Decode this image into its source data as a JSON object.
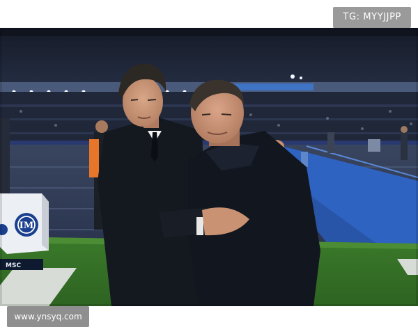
{
  "watermarks": {
    "top_right": "TG: MYYJJPP",
    "bottom_left": "www.ynsyq.com"
  },
  "scene": {
    "ad_box_logo": "inter-crest-icon",
    "ad_board_text": "MSC",
    "stadium_band_text": "",
    "colors": {
      "crowd": "#1c2333",
      "track": "#2a3553",
      "blue_mat": "#2e63c2",
      "grass": "#3f7d2c",
      "coat": "#151a24"
    }
  }
}
